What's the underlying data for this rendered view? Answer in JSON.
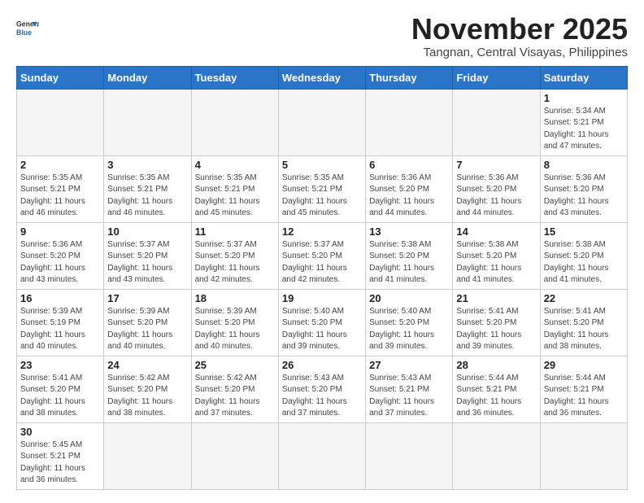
{
  "logo": {
    "line1": "General",
    "line2": "Blue"
  },
  "header": {
    "month": "November 2025",
    "location": "Tangnan, Central Visayas, Philippines"
  },
  "weekdays": [
    "Sunday",
    "Monday",
    "Tuesday",
    "Wednesday",
    "Thursday",
    "Friday",
    "Saturday"
  ],
  "weeks": [
    [
      {
        "day": "",
        "info": ""
      },
      {
        "day": "",
        "info": ""
      },
      {
        "day": "",
        "info": ""
      },
      {
        "day": "",
        "info": ""
      },
      {
        "day": "",
        "info": ""
      },
      {
        "day": "",
        "info": ""
      },
      {
        "day": "1",
        "info": "Sunrise: 5:34 AM\nSunset: 5:21 PM\nDaylight: 11 hours\nand 47 minutes."
      }
    ],
    [
      {
        "day": "2",
        "info": "Sunrise: 5:35 AM\nSunset: 5:21 PM\nDaylight: 11 hours\nand 46 minutes."
      },
      {
        "day": "3",
        "info": "Sunrise: 5:35 AM\nSunset: 5:21 PM\nDaylight: 11 hours\nand 46 minutes."
      },
      {
        "day": "4",
        "info": "Sunrise: 5:35 AM\nSunset: 5:21 PM\nDaylight: 11 hours\nand 45 minutes."
      },
      {
        "day": "5",
        "info": "Sunrise: 5:35 AM\nSunset: 5:21 PM\nDaylight: 11 hours\nand 45 minutes."
      },
      {
        "day": "6",
        "info": "Sunrise: 5:36 AM\nSunset: 5:20 PM\nDaylight: 11 hours\nand 44 minutes."
      },
      {
        "day": "7",
        "info": "Sunrise: 5:36 AM\nSunset: 5:20 PM\nDaylight: 11 hours\nand 44 minutes."
      },
      {
        "day": "8",
        "info": "Sunrise: 5:36 AM\nSunset: 5:20 PM\nDaylight: 11 hours\nand 43 minutes."
      }
    ],
    [
      {
        "day": "9",
        "info": "Sunrise: 5:36 AM\nSunset: 5:20 PM\nDaylight: 11 hours\nand 43 minutes."
      },
      {
        "day": "10",
        "info": "Sunrise: 5:37 AM\nSunset: 5:20 PM\nDaylight: 11 hours\nand 43 minutes."
      },
      {
        "day": "11",
        "info": "Sunrise: 5:37 AM\nSunset: 5:20 PM\nDaylight: 11 hours\nand 42 minutes."
      },
      {
        "day": "12",
        "info": "Sunrise: 5:37 AM\nSunset: 5:20 PM\nDaylight: 11 hours\nand 42 minutes."
      },
      {
        "day": "13",
        "info": "Sunrise: 5:38 AM\nSunset: 5:20 PM\nDaylight: 11 hours\nand 41 minutes."
      },
      {
        "day": "14",
        "info": "Sunrise: 5:38 AM\nSunset: 5:20 PM\nDaylight: 11 hours\nand 41 minutes."
      },
      {
        "day": "15",
        "info": "Sunrise: 5:38 AM\nSunset: 5:20 PM\nDaylight: 11 hours\nand 41 minutes."
      }
    ],
    [
      {
        "day": "16",
        "info": "Sunrise: 5:39 AM\nSunset: 5:19 PM\nDaylight: 11 hours\nand 40 minutes."
      },
      {
        "day": "17",
        "info": "Sunrise: 5:39 AM\nSunset: 5:20 PM\nDaylight: 11 hours\nand 40 minutes."
      },
      {
        "day": "18",
        "info": "Sunrise: 5:39 AM\nSunset: 5:20 PM\nDaylight: 11 hours\nand 40 minutes."
      },
      {
        "day": "19",
        "info": "Sunrise: 5:40 AM\nSunset: 5:20 PM\nDaylight: 11 hours\nand 39 minutes."
      },
      {
        "day": "20",
        "info": "Sunrise: 5:40 AM\nSunset: 5:20 PM\nDaylight: 11 hours\nand 39 minutes."
      },
      {
        "day": "21",
        "info": "Sunrise: 5:41 AM\nSunset: 5:20 PM\nDaylight: 11 hours\nand 39 minutes."
      },
      {
        "day": "22",
        "info": "Sunrise: 5:41 AM\nSunset: 5:20 PM\nDaylight: 11 hours\nand 38 minutes."
      }
    ],
    [
      {
        "day": "23",
        "info": "Sunrise: 5:41 AM\nSunset: 5:20 PM\nDaylight: 11 hours\nand 38 minutes."
      },
      {
        "day": "24",
        "info": "Sunrise: 5:42 AM\nSunset: 5:20 PM\nDaylight: 11 hours\nand 38 minutes."
      },
      {
        "day": "25",
        "info": "Sunrise: 5:42 AM\nSunset: 5:20 PM\nDaylight: 11 hours\nand 37 minutes."
      },
      {
        "day": "26",
        "info": "Sunrise: 5:43 AM\nSunset: 5:20 PM\nDaylight: 11 hours\nand 37 minutes."
      },
      {
        "day": "27",
        "info": "Sunrise: 5:43 AM\nSunset: 5:21 PM\nDaylight: 11 hours\nand 37 minutes."
      },
      {
        "day": "28",
        "info": "Sunrise: 5:44 AM\nSunset: 5:21 PM\nDaylight: 11 hours\nand 36 minutes."
      },
      {
        "day": "29",
        "info": "Sunrise: 5:44 AM\nSunset: 5:21 PM\nDaylight: 11 hours\nand 36 minutes."
      }
    ],
    [
      {
        "day": "30",
        "info": "Sunrise: 5:45 AM\nSunset: 5:21 PM\nDaylight: 11 hours\nand 36 minutes."
      },
      {
        "day": "",
        "info": ""
      },
      {
        "day": "",
        "info": ""
      },
      {
        "day": "",
        "info": ""
      },
      {
        "day": "",
        "info": ""
      },
      {
        "day": "",
        "info": ""
      },
      {
        "day": "",
        "info": ""
      }
    ]
  ]
}
